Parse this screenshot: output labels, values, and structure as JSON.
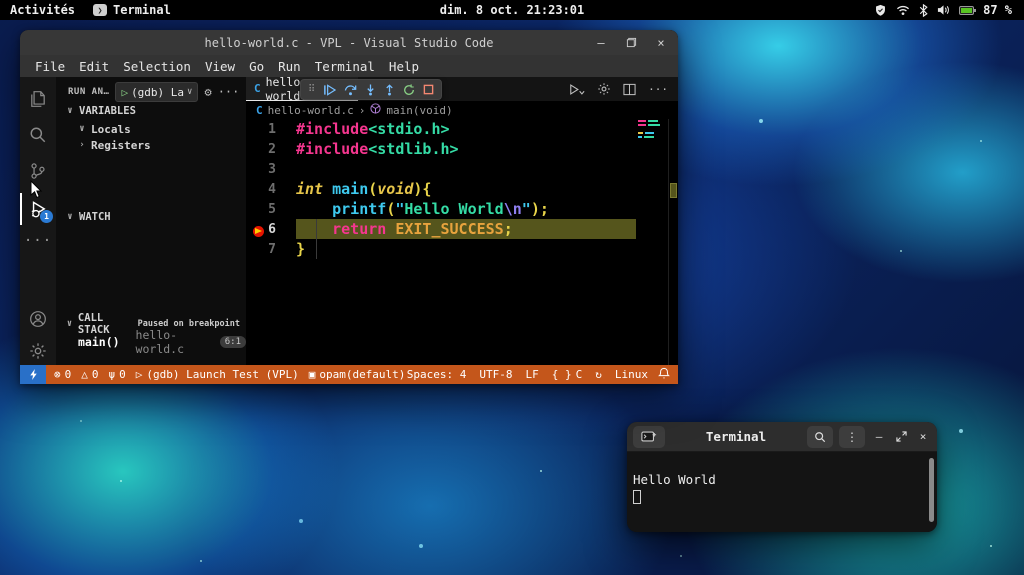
{
  "colors": {
    "orange": "#c4561b",
    "remoteblue": "#2970c8",
    "badgeblue": "#2a7ad4",
    "olive": "#55551c",
    "pink": "#f5368f",
    "teal": "#35dca6",
    "gold": "#e6c54a",
    "cyan": "#3ec9ee",
    "yellow": "#e8d44a",
    "violet": "#8f7ff0",
    "const": "#e8a33d",
    "plain": "#d8d8d8"
  },
  "topbar": {
    "activities": "Activités",
    "app_name": "Terminal",
    "clock": "dim. 8 oct. 21:23:01",
    "battery": "87 %"
  },
  "vscode": {
    "title": "hello-world.c - VPL - Visual Studio Code",
    "window_controls": {
      "minimize": "–",
      "close": "×"
    },
    "menus": [
      "File",
      "Edit",
      "Selection",
      "View",
      "Go",
      "Run",
      "Terminal",
      "Help"
    ],
    "activitybar": {
      "debug_badge": "1",
      "more": "···"
    },
    "sidebar": {
      "header": "RUN AN…",
      "launch_play": "▷",
      "launch_label": "(gdb) La",
      "launch_caret": "∨",
      "gear": "⚙",
      "more": "···",
      "variables": "VARIABLES",
      "locals": "Locals",
      "registers": "Registers",
      "watch": "WATCH",
      "callstack": "CALL STACK",
      "paused": "Paused on breakpoint",
      "frame_fn": "main()",
      "frame_file": "hello-world.c",
      "frame_pos": "6:1",
      "chev_open": "∨",
      "chev_closed": "›"
    },
    "editor": {
      "tab_icon": "C",
      "tab_label": "hello-world.c",
      "tab_actions_more": "···",
      "grip": "⠿",
      "breadcrumb_icon": "C",
      "breadcrumb_file": "hello-world.c",
      "breadcrumb_sep": "›",
      "breadcrumb_symbol": "main(void)",
      "code": [
        {
          "n": "1",
          "tokens": [
            [
              "kw",
              "#include"
            ],
            [
              "str2",
              "<stdio.h>"
            ]
          ]
        },
        {
          "n": "2",
          "tokens": [
            [
              "kw",
              "#include"
            ],
            [
              "str2",
              "<stdlib.h>"
            ]
          ]
        },
        {
          "n": "3",
          "tokens": []
        },
        {
          "n": "4",
          "tokens": [
            [
              "type",
              "int"
            ],
            [
              "plain",
              " "
            ],
            [
              "fn",
              "main"
            ],
            [
              "punc",
              "("
            ],
            [
              "type",
              "void"
            ],
            [
              "punc",
              "){"
            ]
          ]
        },
        {
          "n": "5",
          "tokens": [
            [
              "plain",
              "    "
            ],
            [
              "fn",
              "printf"
            ],
            [
              "punc",
              "("
            ],
            [
              "q",
              "\""
            ],
            [
              "str",
              "Hello World"
            ],
            [
              "esc",
              "\\n"
            ],
            [
              "q",
              "\""
            ],
            [
              "punc",
              ");"
            ]
          ]
        },
        {
          "n": "6",
          "hl": true,
          "bp": true,
          "tokens": [
            [
              "plain",
              "    "
            ],
            [
              "kw",
              "return"
            ],
            [
              "plain",
              " "
            ],
            [
              "const",
              "EXIT_SUCCESS"
            ],
            [
              "punc",
              ";"
            ]
          ]
        },
        {
          "n": "7",
          "tokens": [
            [
              "punc",
              "}"
            ]
          ]
        }
      ]
    },
    "statusbar": {
      "left": [
        {
          "icon": "⊗",
          "name": "errors",
          "text": "0"
        },
        {
          "icon": "△",
          "name": "warnings",
          "text": "0"
        },
        {
          "icon": "ψ",
          "name": "ports",
          "text": "0"
        },
        {
          "icon": "▷",
          "name": "debug-launch",
          "text": "(gdb) Launch Test (VPL)"
        },
        {
          "icon": "▣",
          "name": "opam",
          "text": "opam(default)"
        }
      ],
      "right": [
        {
          "icon": "",
          "name": "indentation",
          "text": "Spaces: 4"
        },
        {
          "icon": "",
          "name": "encoding",
          "text": "UTF-8"
        },
        {
          "icon": "",
          "name": "eol",
          "text": "LF"
        },
        {
          "icon": "{ }",
          "name": "language-mode",
          "text": "C"
        },
        {
          "icon": "↻",
          "name": "sync",
          "text": ""
        },
        {
          "icon": "",
          "name": "os",
          "text": "Linux"
        }
      ]
    }
  },
  "terminal": {
    "title": "Terminal",
    "output": "Hello World",
    "kebab": "⋮",
    "minimize": "–",
    "close": "×"
  }
}
